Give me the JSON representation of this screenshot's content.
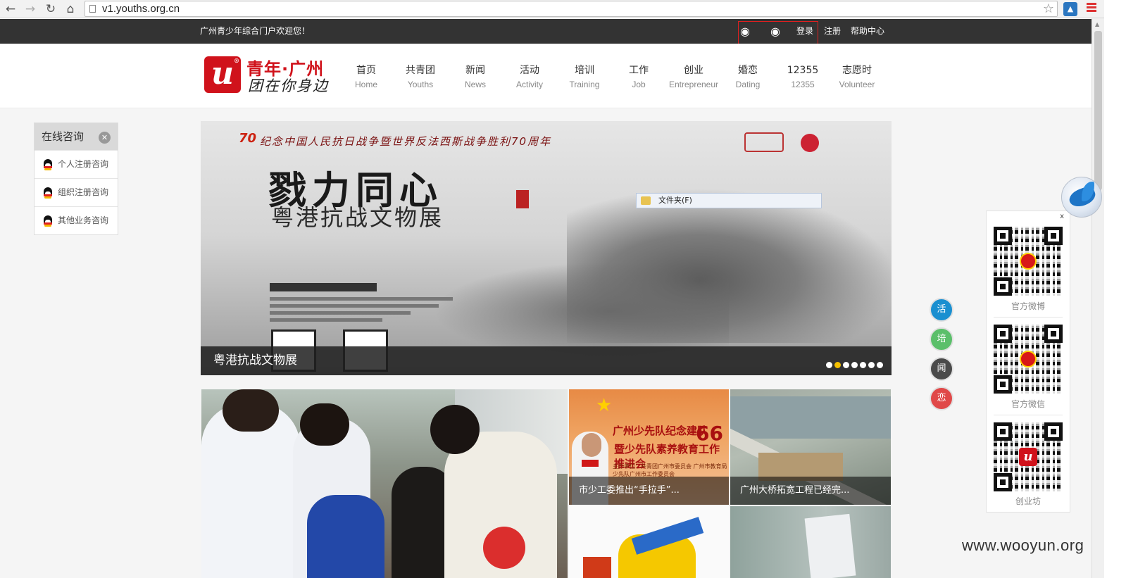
{
  "browser": {
    "url": "v1.youths.org.cn",
    "back_icon": "arrow-left",
    "forward_icon": "arrow-right",
    "reload_icon": "reload",
    "home_icon": "home",
    "bookmark_icon": "star",
    "menu_icon": "hamburger"
  },
  "topbar": {
    "welcome": "广州青少年综合门户欢迎您！",
    "weibo_icon": "weibo",
    "wechat_icon": "wechat",
    "login": "登录",
    "register": "注册",
    "help": "帮助中心"
  },
  "logo": {
    "mark": "u",
    "title": "青年·广州",
    "slogan": "团在你身边"
  },
  "nav": [
    {
      "cn": "首页",
      "en": "Home"
    },
    {
      "cn": "共青团",
      "en": "Youths"
    },
    {
      "cn": "新闻",
      "en": "News"
    },
    {
      "cn": "活动",
      "en": "Activity"
    },
    {
      "cn": "培训",
      "en": "Training"
    },
    {
      "cn": "工作",
      "en": "Job"
    },
    {
      "cn": "创业",
      "en": "Entrepreneur"
    },
    {
      "cn": "婚恋",
      "en": "Dating"
    },
    {
      "cn": "12355",
      "en": "12355"
    },
    {
      "cn": "志愿时",
      "en": "Volunteer"
    }
  ],
  "consult": {
    "title": "在线咨询",
    "items": [
      "个人注册咨询",
      "组织注册咨询",
      "其他业务咨询"
    ]
  },
  "banner": {
    "band_text": "纪念中国人民抗日战争暨世界反法西斯战争胜利70周年",
    "band_num": "70",
    "headline": "戮力同心",
    "subheadline": "粤港抗战文物展",
    "caption": "粤港抗战文物展",
    "slide_count": 7,
    "active_slide": 2
  },
  "context_menu": {
    "item": "文件夹(F)"
  },
  "news": [
    {
      "caption": "市少工委推出“手拉手”..."
    },
    {
      "caption": "广州大桥拓宽工程已经完..."
    }
  ],
  "news_a_poster": {
    "line1": "广州少先队纪念建队",
    "number": "66",
    "line2": "暨少先队素养教育工作推进会",
    "line3": "主办单位：共青团广州市委员会  广州市教育局  少先队广州市工作委员会"
  },
  "float_buttons": [
    {
      "label": "活",
      "color": "#1a8fd0"
    },
    {
      "label": "培",
      "color": "#5bbf6a"
    },
    {
      "label": "闻",
      "color": "#4a4a4a"
    },
    {
      "label": "恋",
      "color": "#e04848"
    }
  ],
  "qr_panel": {
    "close": "x",
    "items": [
      {
        "label": "官方微博"
      },
      {
        "label": "官方微信"
      },
      {
        "label": "创业坊"
      }
    ]
  },
  "watermark": "www.wooyun.org"
}
